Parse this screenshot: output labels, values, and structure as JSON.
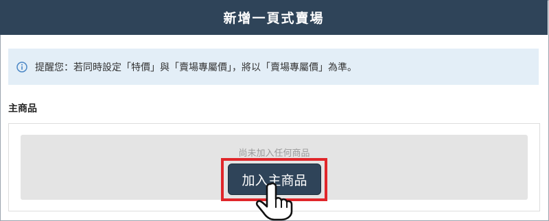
{
  "header": {
    "title": "新增一頁式賣場"
  },
  "notice": {
    "icon": "info-icon",
    "text": "提醒您：若同時設定「特價」與「賣場專屬價」，將以「賣場專屬價」為準。"
  },
  "main_product": {
    "section_title": "主商品",
    "empty_text": "尚未加入任何商品",
    "add_button_label": "加入主商品"
  },
  "colors": {
    "header_bg": "#2f4459",
    "notice_bg": "#e3eef7",
    "highlight": "#e0262a",
    "empty_area_bg": "#e4e4e4"
  },
  "overlay": {
    "cursor": "pointing-hand-cursor-icon"
  }
}
